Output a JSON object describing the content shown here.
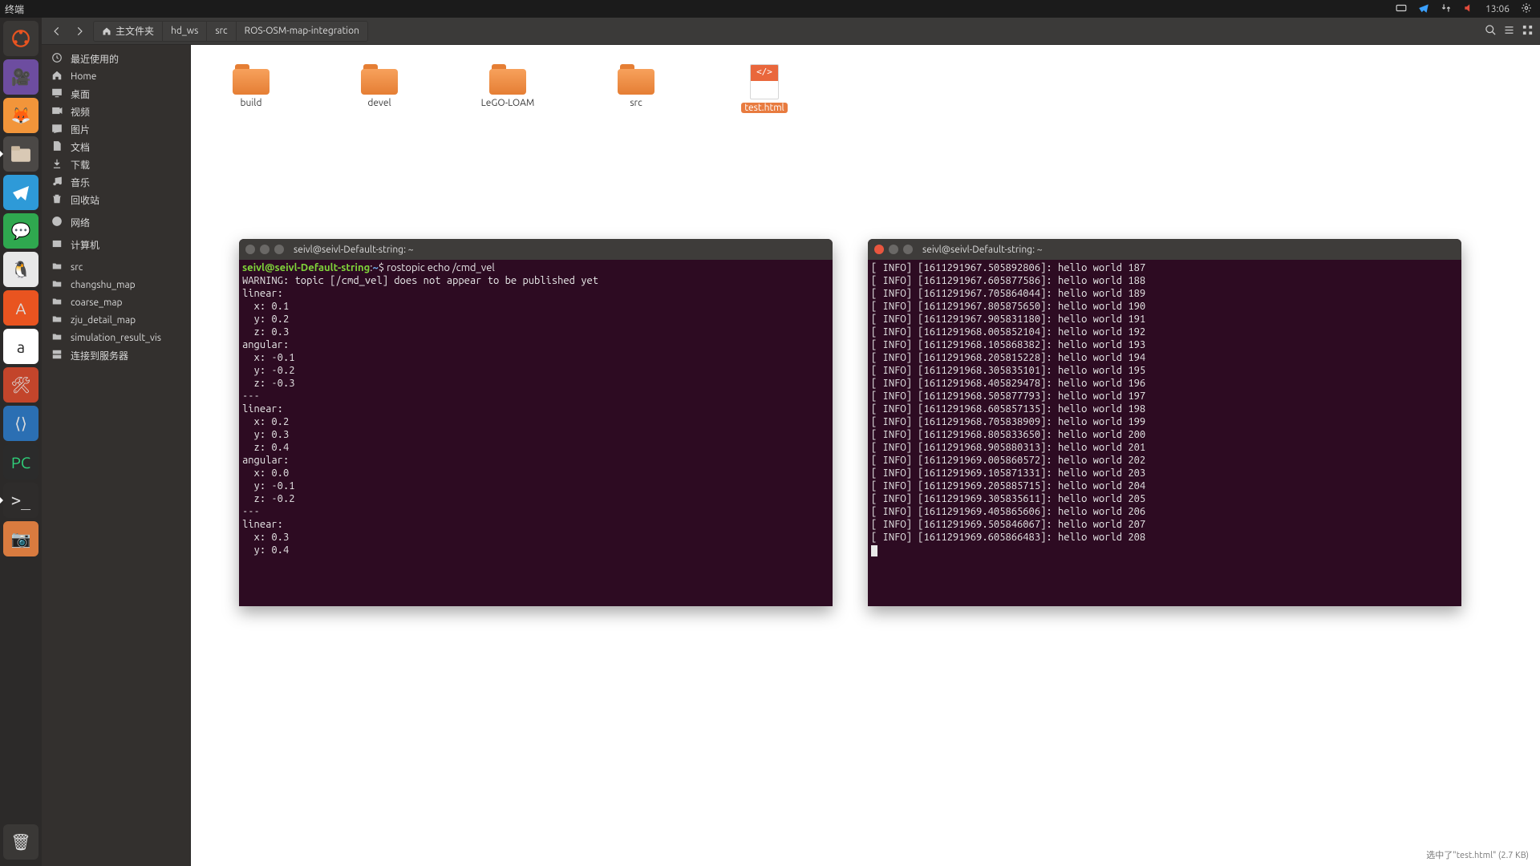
{
  "panel": {
    "title": "终端",
    "time": "13:06"
  },
  "breadcrumbs": {
    "home": "主文件夹",
    "segs": [
      "hd_ws",
      "src",
      "ROS-OSM-map-integration"
    ]
  },
  "sidebar": {
    "sec1": [
      {
        "icon": "clock",
        "label": "最近使用的"
      },
      {
        "icon": "home",
        "label": "Home"
      },
      {
        "icon": "desktop",
        "label": "桌面"
      },
      {
        "icon": "video",
        "label": "视频"
      },
      {
        "icon": "image",
        "label": "图片"
      },
      {
        "icon": "doc",
        "label": "文档"
      },
      {
        "icon": "download",
        "label": "下载"
      },
      {
        "icon": "music",
        "label": "音乐"
      },
      {
        "icon": "trash",
        "label": "回收站"
      }
    ],
    "sec2": [
      {
        "icon": "net",
        "label": "网络"
      }
    ],
    "sec3": [
      {
        "icon": "disk",
        "label": "计算机"
      }
    ],
    "sec4": [
      {
        "icon": "folder",
        "label": "src"
      },
      {
        "icon": "folder",
        "label": "changshu_map"
      },
      {
        "icon": "folder",
        "label": "coarse_map"
      },
      {
        "icon": "folder",
        "label": "zju_detail_map"
      },
      {
        "icon": "folder",
        "label": "simulation_result_vis"
      },
      {
        "icon": "server",
        "label": "连接到服务器"
      }
    ]
  },
  "files": [
    {
      "type": "folder",
      "name": "build"
    },
    {
      "type": "folder",
      "name": "devel"
    },
    {
      "type": "folder",
      "name": "LeGO-LOAM"
    },
    {
      "type": "folder",
      "name": "src"
    },
    {
      "type": "html",
      "name": "test.html",
      "selected": true
    }
  ],
  "status": "选中了\"test.html\" (2.7 KB)",
  "term1": {
    "title": "seivl@seivl-Default-string: ~",
    "prompt_user": "seivl@seivl-Default-string",
    "prompt_path": "~",
    "command": "rostopic echo /cmd_vel",
    "lines": [
      "WARNING: topic [/cmd_vel] does not appear to be published yet",
      "linear:",
      "  x: 0.1",
      "  y: 0.2",
      "  z: 0.3",
      "angular:",
      "  x: -0.1",
      "  y: -0.2",
      "  z: -0.3",
      "---",
      "linear:",
      "  x: 0.2",
      "  y: 0.3",
      "  z: 0.4",
      "angular:",
      "  x: 0.0",
      "  y: -0.1",
      "  z: -0.2",
      "---",
      "linear:",
      "  x: 0.3",
      "  y: 0.4"
    ]
  },
  "term2": {
    "title": "seivl@seivl-Default-string: ~",
    "lines": [
      "[ INFO] [1611291967.505892806]: hello world 187",
      "[ INFO] [1611291967.605877586]: hello world 188",
      "[ INFO] [1611291967.705864044]: hello world 189",
      "[ INFO] [1611291967.805875650]: hello world 190",
      "[ INFO] [1611291967.905831180]: hello world 191",
      "[ INFO] [1611291968.005852104]: hello world 192",
      "[ INFO] [1611291968.105868382]: hello world 193",
      "[ INFO] [1611291968.205815228]: hello world 194",
      "[ INFO] [1611291968.305835101]: hello world 195",
      "[ INFO] [1611291968.405829478]: hello world 196",
      "[ INFO] [1611291968.505877793]: hello world 197",
      "[ INFO] [1611291968.605857135]: hello world 198",
      "[ INFO] [1611291968.705838909]: hello world 199",
      "[ INFO] [1611291968.805833650]: hello world 200",
      "[ INFO] [1611291968.905880313]: hello world 201",
      "[ INFO] [1611291969.005860572]: hello world 202",
      "[ INFO] [1611291969.105871331]: hello world 203",
      "[ INFO] [1611291969.205885715]: hello world 204",
      "[ INFO] [1611291969.305835611]: hello world 205",
      "[ INFO] [1611291969.405865606]: hello world 206",
      "[ INFO] [1611291969.505846067]: hello world 207",
      "[ INFO] [1611291969.605866483]: hello world 208"
    ]
  }
}
